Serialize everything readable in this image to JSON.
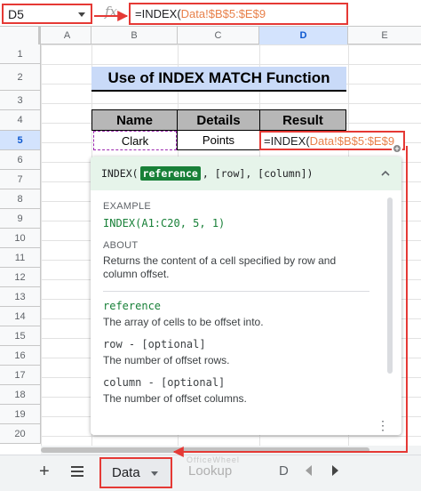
{
  "toolbar": {
    "name_box": "D5",
    "fx_label": "fx",
    "formula_fn": "=INDEX(",
    "formula_ref": "Data!$B$5:$E$9"
  },
  "columns": [
    "A",
    "B",
    "C",
    "D",
    "E"
  ],
  "active_column": "D",
  "rows": [
    "1",
    "2",
    "3",
    "4",
    "5",
    "6",
    "7",
    "8",
    "9",
    "10",
    "11",
    "12",
    "13",
    "14",
    "15",
    "16",
    "17",
    "18",
    "19",
    "20"
  ],
  "active_row": "5",
  "sheet": {
    "title": "Use of INDEX MATCH Function",
    "headers": [
      "Name",
      "Details",
      "Result"
    ],
    "row": {
      "name": "Clark",
      "details": "Points",
      "result_fn": "=INDEX(",
      "result_ref": "Data!$B$5:$E$9"
    }
  },
  "help": {
    "sig_fn": "INDEX(",
    "sig_arg_active": "reference",
    "sig_rest": ", [row], [column])",
    "example_label": "EXAMPLE",
    "example_code": "INDEX(A1:C20, 5, 1)",
    "about_label": "ABOUT",
    "about_text": "Returns the content of a cell specified by row and column offset.",
    "params": [
      {
        "name": "reference",
        "desc": "The array of cells to be offset into."
      },
      {
        "name": "row - [optional]",
        "desc": "The number of offset rows."
      },
      {
        "name": "column - [optional]",
        "desc": "The number of offset columns."
      }
    ]
  },
  "tabs": {
    "add": "+",
    "active": "Data",
    "lookup": "Lookup",
    "truncated": "D",
    "watermark": "OfficeWheel"
  },
  "colors": {
    "annotation_red": "#e53935",
    "title_bg": "#c9daf8",
    "header_bg": "#b7b7b7",
    "help_head_bg": "#e6f4ea",
    "param_green": "#188038",
    "ref_orange": "#e8804a"
  }
}
